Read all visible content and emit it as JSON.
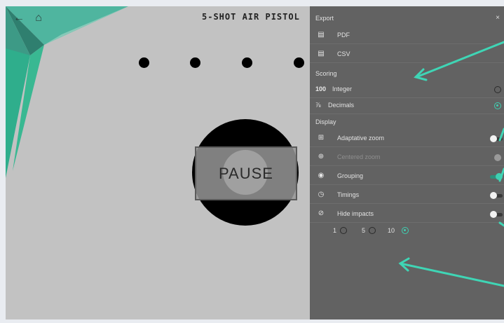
{
  "header": {
    "title": "5-SHOT AIR PISTOL",
    "back_icon": "arrow-left-icon",
    "home_icon": "home-icon"
  },
  "target": {
    "pause_label": "PAUSE",
    "shot_count": 4
  },
  "panel": {
    "close_label": "×",
    "export": {
      "title": "Export",
      "items": [
        {
          "label": "PDF",
          "icon": "file-icon"
        },
        {
          "label": "CSV",
          "icon": "file-icon"
        }
      ]
    },
    "scoring": {
      "title": "Scoring",
      "options": [
        {
          "prefix": "100",
          "label": "Integer",
          "selected": false
        },
        {
          "prefix": "⅞",
          "label": "Decimals",
          "selected": true
        }
      ]
    },
    "display": {
      "title": "Display",
      "items": [
        {
          "label": "Adaptative zoom",
          "on": false,
          "disabled": false,
          "icon": "crop-icon"
        },
        {
          "label": "Centered zoom",
          "on": false,
          "disabled": true,
          "icon": "crosshair-icon"
        },
        {
          "label": "Grouping",
          "on": true,
          "disabled": false,
          "icon": "eye-icon"
        },
        {
          "label": "Timings",
          "on": false,
          "disabled": false,
          "icon": "timer-icon"
        },
        {
          "label": "Hide impacts",
          "on": false,
          "disabled": false,
          "icon": "hide-icon"
        }
      ],
      "impact_counts": [
        {
          "label": "1",
          "selected": false
        },
        {
          "label": "5",
          "selected": false
        },
        {
          "label": "10",
          "selected": true
        }
      ]
    }
  },
  "colors": {
    "accent": "#3fcfb1",
    "panel_bg": "#626262",
    "canvas_bg": "#c2c2c2",
    "arrow": "#3fd5b5"
  }
}
